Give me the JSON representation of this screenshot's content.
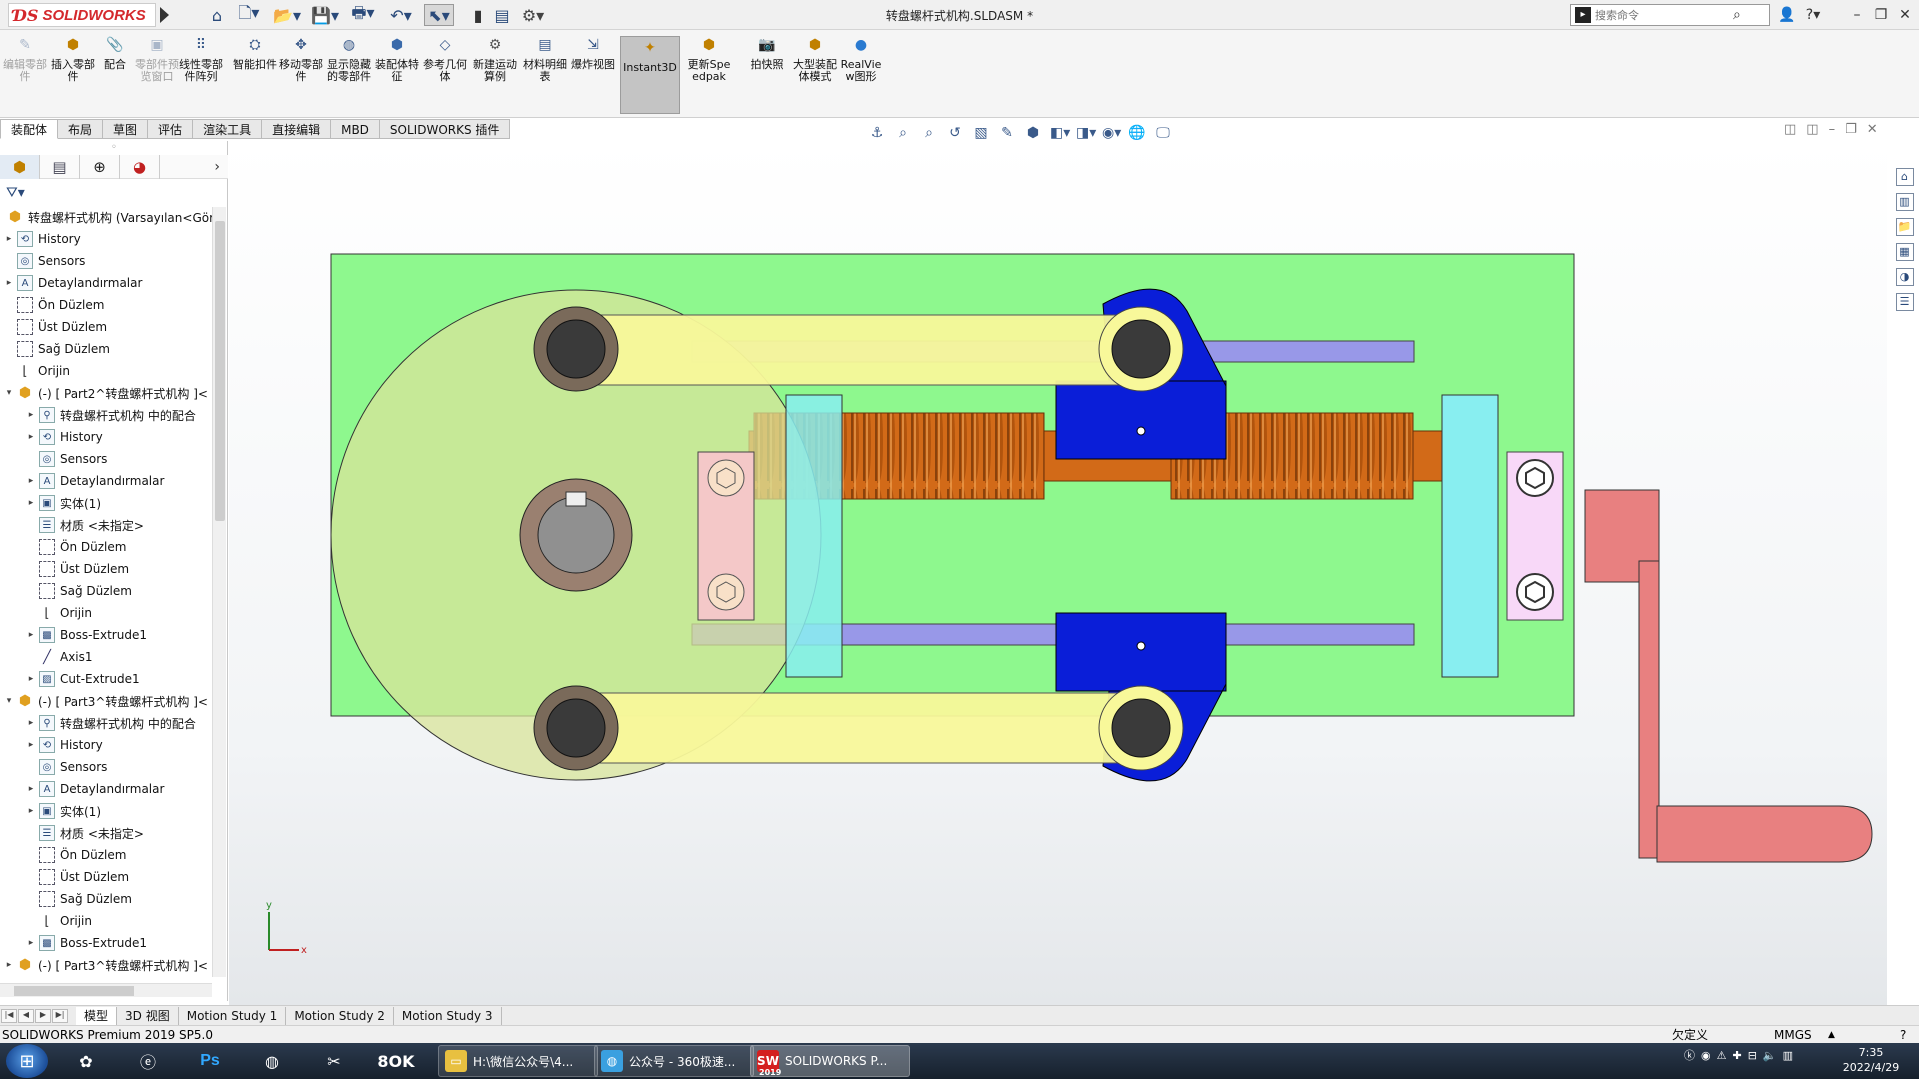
{
  "app": {
    "brand": "SOLIDWORKS",
    "doc_title": "转盘螺杆式机构.SLDASM *",
    "search_placeholder": "搜索命令"
  },
  "commands": [
    {
      "label": "编辑零部件",
      "icon": "edit-component-icon",
      "disabled": true
    },
    {
      "label": "插入零部件",
      "icon": "insert-component-icon",
      "disabled": false
    },
    {
      "label": "配合",
      "icon": "mate-icon",
      "disabled": false
    },
    {
      "label": "零部件预览窗口",
      "icon": "preview-window-icon",
      "disabled": true
    },
    {
      "label": "线性零部件阵列",
      "icon": "linear-pattern-icon",
      "disabled": false
    },
    {
      "label": "智能扣件",
      "icon": "smart-fastener-icon",
      "disabled": false
    },
    {
      "label": "移动零部件",
      "icon": "move-component-icon",
      "disabled": false
    },
    {
      "label": "显示隐藏的零部件",
      "icon": "show-hidden-icon",
      "disabled": false
    },
    {
      "label": "装配体特征",
      "icon": "assembly-feature-icon",
      "disabled": false
    },
    {
      "label": "参考几何体",
      "icon": "reference-geometry-icon",
      "disabled": false
    },
    {
      "label": "新建运动算例",
      "icon": "motion-study-icon",
      "disabled": false
    },
    {
      "label": "材料明细表",
      "icon": "bom-icon",
      "disabled": false
    },
    {
      "label": "爆炸视图",
      "icon": "exploded-view-icon",
      "disabled": false
    },
    {
      "label": "Instant3D",
      "icon": "instant3d-icon",
      "disabled": false,
      "active": true
    },
    {
      "label": "更新Speedpak",
      "icon": "speedpak-icon",
      "disabled": false
    },
    {
      "label": "拍快照",
      "icon": "snapshot-icon",
      "disabled": false
    },
    {
      "label": "大型装配体模式",
      "icon": "large-assembly-icon",
      "disabled": false
    },
    {
      "label": "RealView图形",
      "icon": "realview-icon",
      "disabled": false
    }
  ],
  "cmd_tabs": [
    "装配体",
    "布局",
    "草图",
    "评估",
    "渲染工具",
    "直接编辑",
    "MBD",
    "SOLIDWORKS 插件"
  ],
  "tree": {
    "root": "转盘螺杆式机构  (Varsayılan<Gör",
    "items": [
      {
        "label": "History",
        "icon": "history-icon",
        "level": 1,
        "exp": true
      },
      {
        "label": "Sensors",
        "icon": "sensors-icon",
        "level": 1,
        "exp": false
      },
      {
        "label": "Detaylandırmalar",
        "icon": "annotations-icon",
        "level": 1,
        "exp": true
      },
      {
        "label": "Ön Düzlem",
        "icon": "plane-icon",
        "level": 1,
        "exp": false
      },
      {
        "label": "Üst Düzlem",
        "icon": "plane-icon",
        "level": 1,
        "exp": false
      },
      {
        "label": "Sağ Düzlem",
        "icon": "plane-icon",
        "level": 1,
        "exp": false
      },
      {
        "label": "Orijin",
        "icon": "origin-icon",
        "level": 1,
        "exp": false
      },
      {
        "label": "(-) [ Part2^转盘螺杆式机构 ]<",
        "icon": "part-icon",
        "level": 1,
        "exp": "open"
      },
      {
        "label": "转盘螺杆式机构 中的配合",
        "icon": "mates-icon",
        "level": 2,
        "exp": true
      },
      {
        "label": "History",
        "icon": "history-icon",
        "level": 2,
        "exp": true
      },
      {
        "label": "Sensors",
        "icon": "sensors-icon",
        "level": 2,
        "exp": false
      },
      {
        "label": "Detaylandırmalar",
        "icon": "annotations-icon",
        "level": 2,
        "exp": true
      },
      {
        "label": "实体(1)",
        "icon": "solid-bodies-icon",
        "level": 2,
        "exp": true
      },
      {
        "label": "材质 <未指定>",
        "icon": "material-icon",
        "level": 2,
        "exp": false
      },
      {
        "label": "Ön Düzlem",
        "icon": "plane-icon",
        "level": 2,
        "exp": false
      },
      {
        "label": "Üst Düzlem",
        "icon": "plane-icon",
        "level": 2,
        "exp": false
      },
      {
        "label": "Sağ Düzlem",
        "icon": "plane-icon",
        "level": 2,
        "exp": false
      },
      {
        "label": "Orijin",
        "icon": "origin-icon",
        "level": 2,
        "exp": false
      },
      {
        "label": "Boss-Extrude1",
        "icon": "boss-extrude-icon",
        "level": 2,
        "exp": true
      },
      {
        "label": "Axis1",
        "icon": "axis-icon",
        "level": 2,
        "exp": false
      },
      {
        "label": "Cut-Extrude1",
        "icon": "cut-extrude-icon",
        "level": 2,
        "exp": true
      },
      {
        "label": "(-) [ Part3^转盘螺杆式机构 ]<",
        "icon": "part-icon",
        "level": 1,
        "exp": "open"
      },
      {
        "label": "转盘螺杆式机构 中的配合",
        "icon": "mates-icon",
        "level": 2,
        "exp": true
      },
      {
        "label": "History",
        "icon": "history-icon",
        "level": 2,
        "exp": true
      },
      {
        "label": "Sensors",
        "icon": "sensors-icon",
        "level": 2,
        "exp": false
      },
      {
        "label": "Detaylandırmalar",
        "icon": "annotations-icon",
        "level": 2,
        "exp": true
      },
      {
        "label": "实体(1)",
        "icon": "solid-bodies-icon",
        "level": 2,
        "exp": true
      },
      {
        "label": "材质 <未指定>",
        "icon": "material-icon",
        "level": 2,
        "exp": false
      },
      {
        "label": "Ön Düzlem",
        "icon": "plane-icon",
        "level": 2,
        "exp": false
      },
      {
        "label": "Üst Düzlem",
        "icon": "plane-icon",
        "level": 2,
        "exp": false
      },
      {
        "label": "Sağ Düzlem",
        "icon": "plane-icon",
        "level": 2,
        "exp": false
      },
      {
        "label": "Orijin",
        "icon": "origin-icon",
        "level": 2,
        "exp": false
      },
      {
        "label": "Boss-Extrude1",
        "icon": "boss-extrude-icon",
        "level": 2,
        "exp": true
      },
      {
        "label": "(-) [ Part3^转盘螺杆式机构 ]<",
        "icon": "part-icon",
        "level": 1,
        "exp": "closed"
      }
    ]
  },
  "bottom_tabs": [
    "模型",
    "3D 视图",
    "Motion Study 1",
    "Motion Study 2",
    "Motion Study 3"
  ],
  "status": {
    "product": "SOLIDWORKS Premium 2019 SP5.0",
    "definition": "欠定义",
    "units": "MMGS"
  },
  "taskbar": {
    "windows": [
      {
        "label": "H:\\微信公众号\\4...",
        "icon": "folder-icon"
      },
      {
        "label": "公众号 - 360极速...",
        "icon": "browser-360-icon"
      },
      {
        "label": "SOLIDWORKS P...",
        "icon": "solidworks-icon",
        "badge": "2019"
      }
    ],
    "time": "7:35",
    "date": "2022/4/29"
  },
  "triad": {
    "x": "x",
    "y": "y"
  },
  "colors": {
    "base_plate": "#8ef88e",
    "disc": "#c8e89a",
    "link_arm": "#f8f89a",
    "slider_block": "#0a1ed8",
    "guide_rod": "#9898e8",
    "end_support": "#88eef0",
    "screw": "#d26a18",
    "bearing_block": "#f4c8c8",
    "crank": "#e88080"
  }
}
